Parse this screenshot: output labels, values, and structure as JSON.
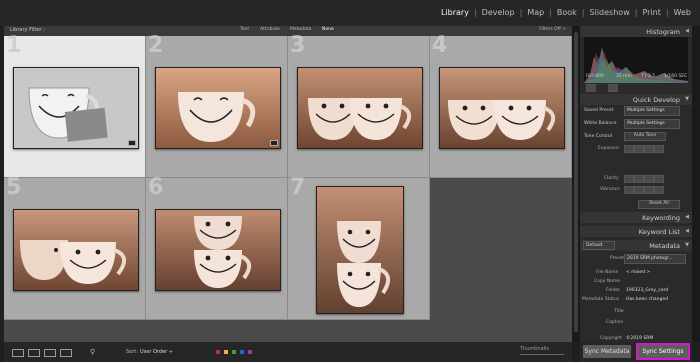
{
  "modules": [
    "Library",
    "Develop",
    "Map",
    "Book",
    "Slideshow",
    "Print",
    "Web"
  ],
  "active_module": "Library",
  "filter_bar": {
    "title": "Library Filter :",
    "options": [
      "Text",
      "Attribute",
      "Metadata",
      "None"
    ],
    "active": "None",
    "filters_off": "Filters Off ÷"
  },
  "grid": {
    "cells": [
      {
        "index": "1"
      },
      {
        "index": "2"
      },
      {
        "index": "3"
      },
      {
        "index": "4"
      },
      {
        "index": "5"
      },
      {
        "index": "6"
      },
      {
        "index": "7"
      }
    ]
  },
  "bottom_toolbar": {
    "sort_label": "Sort:",
    "sort_value": "User Order ÷",
    "thumbnails_label": "Thumbnails"
  },
  "histogram": {
    "title": "Histogram",
    "iso": "ISO 800",
    "focal": "35 mm",
    "aperture": "f / 2.5",
    "shutter": "1/160 SEC"
  },
  "quick_develop": {
    "title": "Quick Develop",
    "saved_preset_label": "Saved Preset",
    "saved_preset_value": "Multiple Settings",
    "white_balance_label": "White Balance",
    "white_balance_value": "Multiple Settings",
    "tone_control_label": "Tone Control",
    "auto_tone_label": "Auto Tone",
    "exposure_label": "Exposure",
    "clarity_label": "Clarity",
    "vibrance_label": "Vibrance",
    "reset_label": "Reset All"
  },
  "keywording": {
    "title": "Keywording"
  },
  "keyword_list": {
    "title": "Keyword List"
  },
  "metadata": {
    "title": "Metadata",
    "preset_select": "Default",
    "preset_label": "Preset",
    "preset_value": "2019 SRM photogr...",
    "file_name_label": "File Name",
    "file_name_value": "< mixed >",
    "copy_name_label": "Copy Name",
    "folder_label": "Folder",
    "folder_value": "190323_Grey_card",
    "status_label": "Metadata Status",
    "status_value": "Has been changed",
    "title_label": "Title",
    "caption_label": "Caption",
    "copyright_label": "Copyright",
    "copyright_value": "©2019 SRM"
  },
  "sync": {
    "metadata_label": "Sync Metadata",
    "settings_label": "Sync Settings"
  },
  "colors": {
    "highlight": "#d21acb"
  }
}
